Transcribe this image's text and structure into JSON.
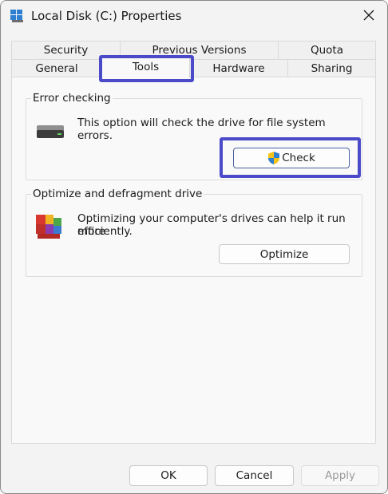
{
  "window": {
    "title": "Local Disk (C:) Properties",
    "icon": "drive-icon",
    "close_icon": "close-icon"
  },
  "tabs": {
    "row1": [
      {
        "label": "Security"
      },
      {
        "label": "Previous Versions"
      },
      {
        "label": "Quota"
      }
    ],
    "row2": [
      {
        "label": "General"
      },
      {
        "label": "Tools"
      },
      {
        "label": "Hardware"
      },
      {
        "label": "Sharing"
      }
    ],
    "active": "Tools"
  },
  "error_checking": {
    "title": "Error checking",
    "description": "This option will check the drive for file system errors.",
    "line1": "This option will check the drive for file system",
    "line2": "errors.",
    "button_label": "Check",
    "icon": "hard-drive-icon",
    "button_icon": "uac-shield-icon"
  },
  "optimize": {
    "title": "Optimize and defragment drive",
    "line1": "Optimizing your computer's drives can help it run more",
    "line2": "efficiently.",
    "button_label": "Optimize",
    "icon": "defrag-icon"
  },
  "footer": {
    "ok_label": "OK",
    "cancel_label": "Cancel",
    "apply_label": "Apply"
  },
  "colors": {
    "highlight": "#4b4bc9",
    "background": "#f3f3f3",
    "panel": "#f9f9f9"
  }
}
